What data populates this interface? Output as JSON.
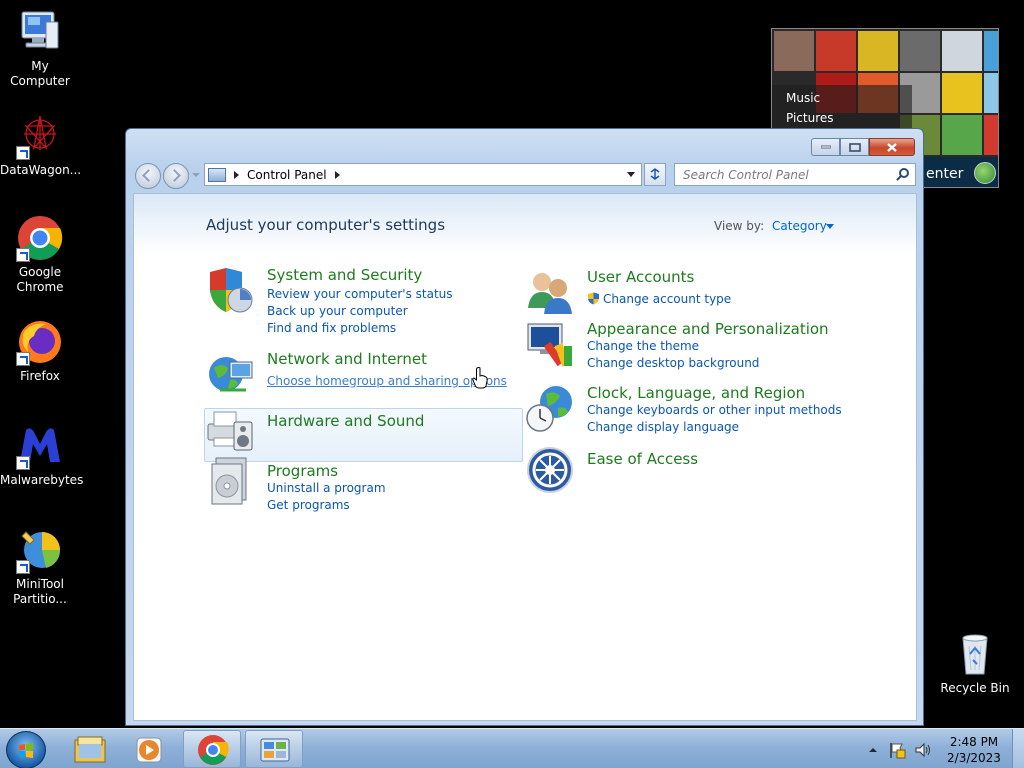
{
  "desktop": {
    "icons": [
      {
        "label": "My Computer",
        "icon": "computer-icon"
      },
      {
        "label": "DataWagon...",
        "icon": "datawagon-icon"
      },
      {
        "label": "Google Chrome",
        "icon": "chrome-icon"
      },
      {
        "label": "Firefox",
        "icon": "firefox-icon"
      },
      {
        "label": "Malwarebytes",
        "icon": "malwarebytes-icon"
      },
      {
        "label": "MiniTool Partitio...",
        "icon": "minitool-icon"
      },
      {
        "label": "Recycle Bin",
        "icon": "recycle-bin-icon"
      }
    ],
    "gadget": {
      "menu": [
        "Music",
        "Pictures"
      ],
      "footer": "enter"
    }
  },
  "window": {
    "address": {
      "path": [
        "Control Panel"
      ]
    },
    "search": {
      "placeholder": "Search Control Panel"
    },
    "title": "Adjust your computer's settings",
    "view_by": {
      "label": "View by:",
      "value": "Category"
    },
    "categories_left": [
      {
        "title": "System and Security",
        "icon": "security-shield-icon",
        "links": [
          "Review your computer's status",
          "Back up your computer",
          "Find and fix problems"
        ]
      },
      {
        "title": "Network and Internet",
        "icon": "network-globe-icon",
        "links": [
          "Choose homegroup and sharing options"
        ]
      },
      {
        "title": "Hardware and Sound",
        "icon": "printer-icon",
        "links": []
      },
      {
        "title": "Programs",
        "icon": "programs-icon",
        "links": [
          "Uninstall a program",
          "Get programs"
        ]
      }
    ],
    "categories_right": [
      {
        "title": "User Accounts",
        "icon": "users-icon",
        "links": [
          "Change account type"
        ]
      },
      {
        "title": "Appearance and Personalization",
        "icon": "monitor-paint-icon",
        "links": [
          "Change the theme",
          "Change desktop background"
        ]
      },
      {
        "title": "Clock, Language, and Region",
        "icon": "clock-globe-icon",
        "links": [
          "Change keyboards or other input methods",
          "Change display language"
        ]
      },
      {
        "title": "Ease of Access",
        "icon": "ease-of-access-icon",
        "links": []
      }
    ]
  },
  "taskbar": {
    "clock": {
      "time": "2:48 PM",
      "date": "2/3/2023"
    },
    "buttons": [
      "explorer-icon",
      "media-player-icon",
      "chrome-icon",
      "control-panel-icon"
    ]
  },
  "colors": {
    "category_title": "#1e7b1e",
    "link": "#0b56b2",
    "heading": "#1e395b",
    "taskbar": "#8fb1d8"
  }
}
